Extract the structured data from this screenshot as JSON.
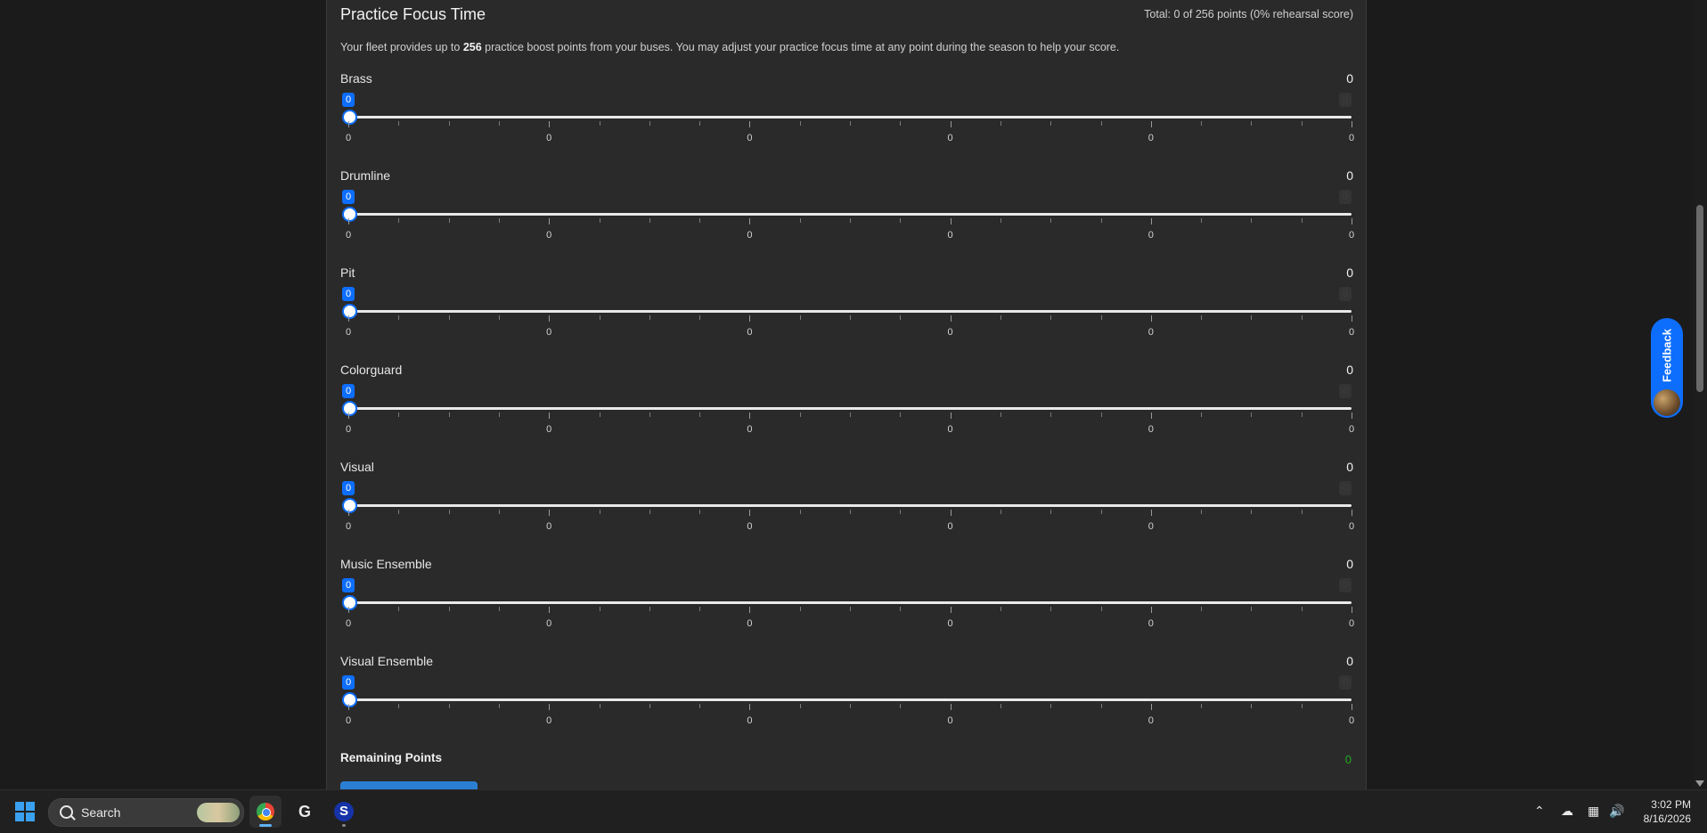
{
  "panel": {
    "title": "Practice Focus Time",
    "total": "Total: 0 of 256 points (0% rehearsal score)",
    "desc_pre": "Your fleet provides up to ",
    "desc_bold": "256",
    "desc_post": " practice boost points from your buses. You may adjust your practice focus time at any point during the season to help your score."
  },
  "sections": [
    {
      "label": "Brass",
      "value": "0",
      "bubble": "0",
      "max_bubble": "0",
      "slider_value": 0,
      "tick_labels": [
        "0",
        "0",
        "0",
        "0",
        "0",
        "0"
      ]
    },
    {
      "label": "Drumline",
      "value": "0",
      "bubble": "0",
      "max_bubble": "0",
      "slider_value": 0,
      "tick_labels": [
        "0",
        "0",
        "0",
        "0",
        "0",
        "0"
      ]
    },
    {
      "label": "Pit",
      "value": "0",
      "bubble": "0",
      "max_bubble": "0",
      "slider_value": 0,
      "tick_labels": [
        "0",
        "0",
        "0",
        "0",
        "0",
        "0"
      ]
    },
    {
      "label": "Colorguard",
      "value": "0",
      "bubble": "0",
      "max_bubble": "0",
      "slider_value": 0,
      "tick_labels": [
        "0",
        "0",
        "0",
        "0",
        "0",
        "0"
      ]
    },
    {
      "label": "Visual",
      "value": "0",
      "bubble": "0",
      "max_bubble": "0",
      "slider_value": 0,
      "tick_labels": [
        "0",
        "0",
        "0",
        "0",
        "0",
        "0"
      ]
    },
    {
      "label": "Music Ensemble",
      "value": "0",
      "bubble": "0",
      "max_bubble": "0",
      "slider_value": 0,
      "tick_labels": [
        "0",
        "0",
        "0",
        "0",
        "0",
        "0"
      ]
    },
    {
      "label": "Visual Ensemble",
      "value": "0",
      "bubble": "0",
      "max_bubble": "0",
      "slider_value": 0,
      "tick_labels": [
        "0",
        "0",
        "0",
        "0",
        "0",
        "0"
      ]
    }
  ],
  "remaining": {
    "label": "Remaining Points",
    "value": "0",
    "value_color": "#22aa22"
  },
  "feedback": {
    "label": "Feedback",
    "color": "#0d6efd"
  },
  "taskbar": {
    "search_placeholder": "Search",
    "apps": [
      "chrome-icon",
      "g-hub-icon",
      "s-app-icon"
    ],
    "tray": [
      "chevron-up-icon",
      "onedrive-icon",
      "network-icon",
      "volume-icon"
    ],
    "time": "3:02 PM",
    "date": "8/16/2026"
  },
  "colors": {
    "accent": "#0d6efd",
    "panel_bg": "#2a2a2a",
    "page_bg": "#1b1b1b"
  }
}
